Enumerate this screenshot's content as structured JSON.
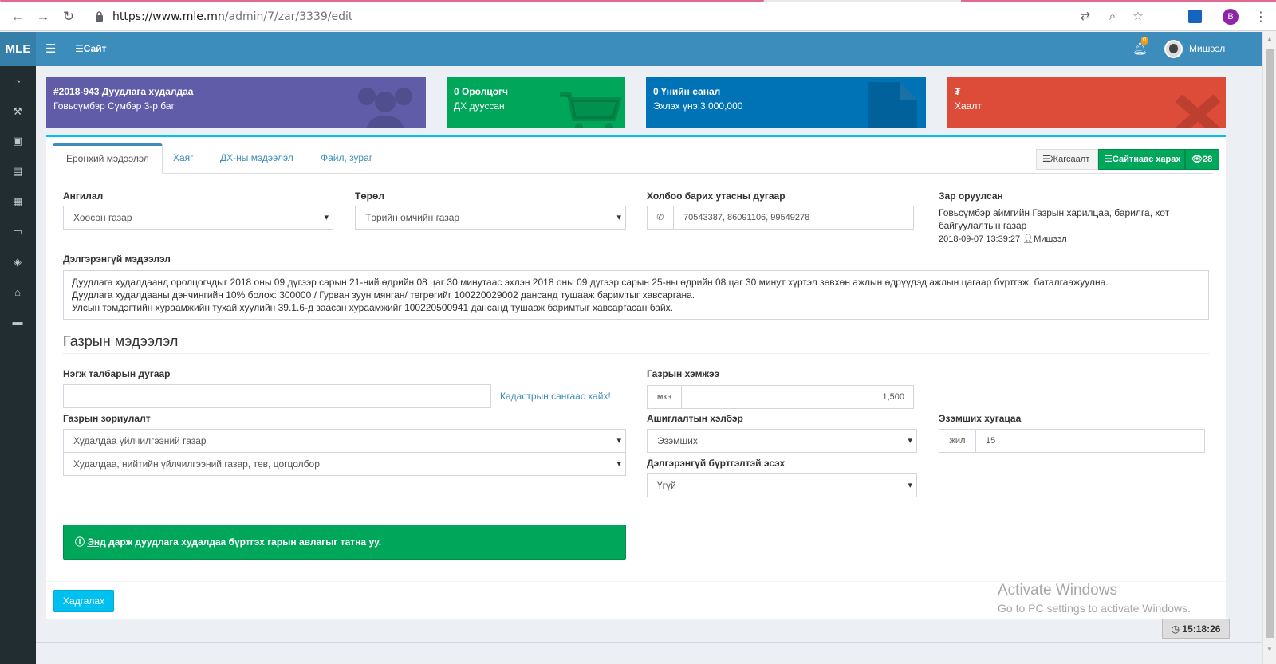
{
  "browser": {
    "url_host": "https://www.mle.mn",
    "url_path": "/admin/7/zar/3339/edit",
    "profile_initial": "B"
  },
  "header": {
    "logo": "MLE",
    "site_link": "Сайт",
    "notification_count": "0",
    "username": "Мишээл"
  },
  "sidebar": {
    "icons": [
      "dashboard-icon",
      "gavel-icon",
      "briefcase-icon",
      "building-icon",
      "calendar-check-icon",
      "money-icon",
      "cubes-icon",
      "bank-icon",
      "archive-icon"
    ]
  },
  "info_boxes": [
    {
      "title": "#2018-943 Дуудлага худалдаа",
      "subtitle": "Говьсүмбэр Сүмбэр 3-р баг",
      "color": "#605ca8",
      "icon": "users-icon"
    },
    {
      "title": "0 Оролцогч",
      "subtitle": "ДХ дууссан",
      "color": "#00a65a",
      "icon": "cart-icon"
    },
    {
      "title": "0 Үнийн санал",
      "subtitle": "Эхлэх үнэ:3,000,000",
      "color": "#0073b7",
      "icon": "file-icon"
    },
    {
      "title": "₮",
      "subtitle": "Хаалт",
      "color": "#dd4b39",
      "icon": "close-icon"
    }
  ],
  "tabs": [
    "Ерөнхий мэдээлэл",
    "Хаяг",
    "ДХ-ны мэдээлэл",
    "Файл, зураг"
  ],
  "toolbar": {
    "list_label": "Жагсаалт",
    "view_site_label": "Сайтнаас харах",
    "views_count": "28"
  },
  "form": {
    "category_label": "Ангилал",
    "category_value": "Хоосон газар",
    "type_label": "Төрөл",
    "type_value": "Төрийн өмчийн газар",
    "phone_label": "Холбоо барих утасны дугаар",
    "phone_value": "70543387, 86091106, 99549278",
    "posted_label": "Зар оруулсан",
    "posted_by_org": "Говьсүмбэр аймгийн Газрын харилцаа, барилга, хот байгуулалтын газар",
    "posted_date": "2018-09-07 13:39:27",
    "posted_user": "Мишээл",
    "details_label": "Дэлгэрэнгүй мэдээлэл",
    "details_lines": [
      "Дуудлага худалдаанд оролцогчдыг 2018 оны 09 дүгээр сарын 21-ний өдрийн 08 цаг 30 минутаас эхлэн 2018 оны 09 дүгээр сарын 25-ны өдрийн 08 цаг 30 минут хүртэл зөвхөн ажлын өдрүүдэд ажлын цагаар бүртгэж, баталгаажуулна.",
      "Дуудлага худалдааны дэнчингийн 10% болох:  300000 / Гурван зуун мянган/ төгрөгийг 100220029002 дансанд тушааж баримтыг хавсаргана.",
      "Улсын тэмдэгтийн хураамжийн тухай хуулийн 39.1.6-д заасан хураамжийг 100220500941 дансанд тушааж баримтыг хавсаргасан байх."
    ]
  },
  "land": {
    "section_title": "Газрын мэдээлэл",
    "parcel_label": "Нэгж талбарын дугаар",
    "parcel_value": "",
    "cadastre_link": "Кадастрын сангаас хайх!",
    "size_label": "Газрын хэмжээ",
    "size_unit": "мкв",
    "size_value": "1,500",
    "purpose_label": "Газрын зориулалт",
    "purpose_value1": "Худалдаа үйлчилгээний газар",
    "purpose_value2": "Худалдаа, нийтийн үйлчилгээний газар, төв, цогцолбор",
    "usage_label": "Ашиглалтын хэлбэр",
    "usage_value": "Эзэмших",
    "term_label": "Эзэмших хугацаа",
    "term_unit": "жил",
    "term_value": "15",
    "detailed_reg_label": "Дэлгэрэнгүй бүртгэлтэй эсэх",
    "detailed_reg_value": "Үгүй"
  },
  "alert": {
    "link_text": "Энд",
    "text": " дарж дуудлага худалдаа бүртгэх гарын авлагыг татна уу."
  },
  "save_label": "Хадгалах",
  "watermark": {
    "line1": "Activate Windows",
    "line2": "Go to PC settings to activate Windows."
  },
  "clock": "15:18:26"
}
